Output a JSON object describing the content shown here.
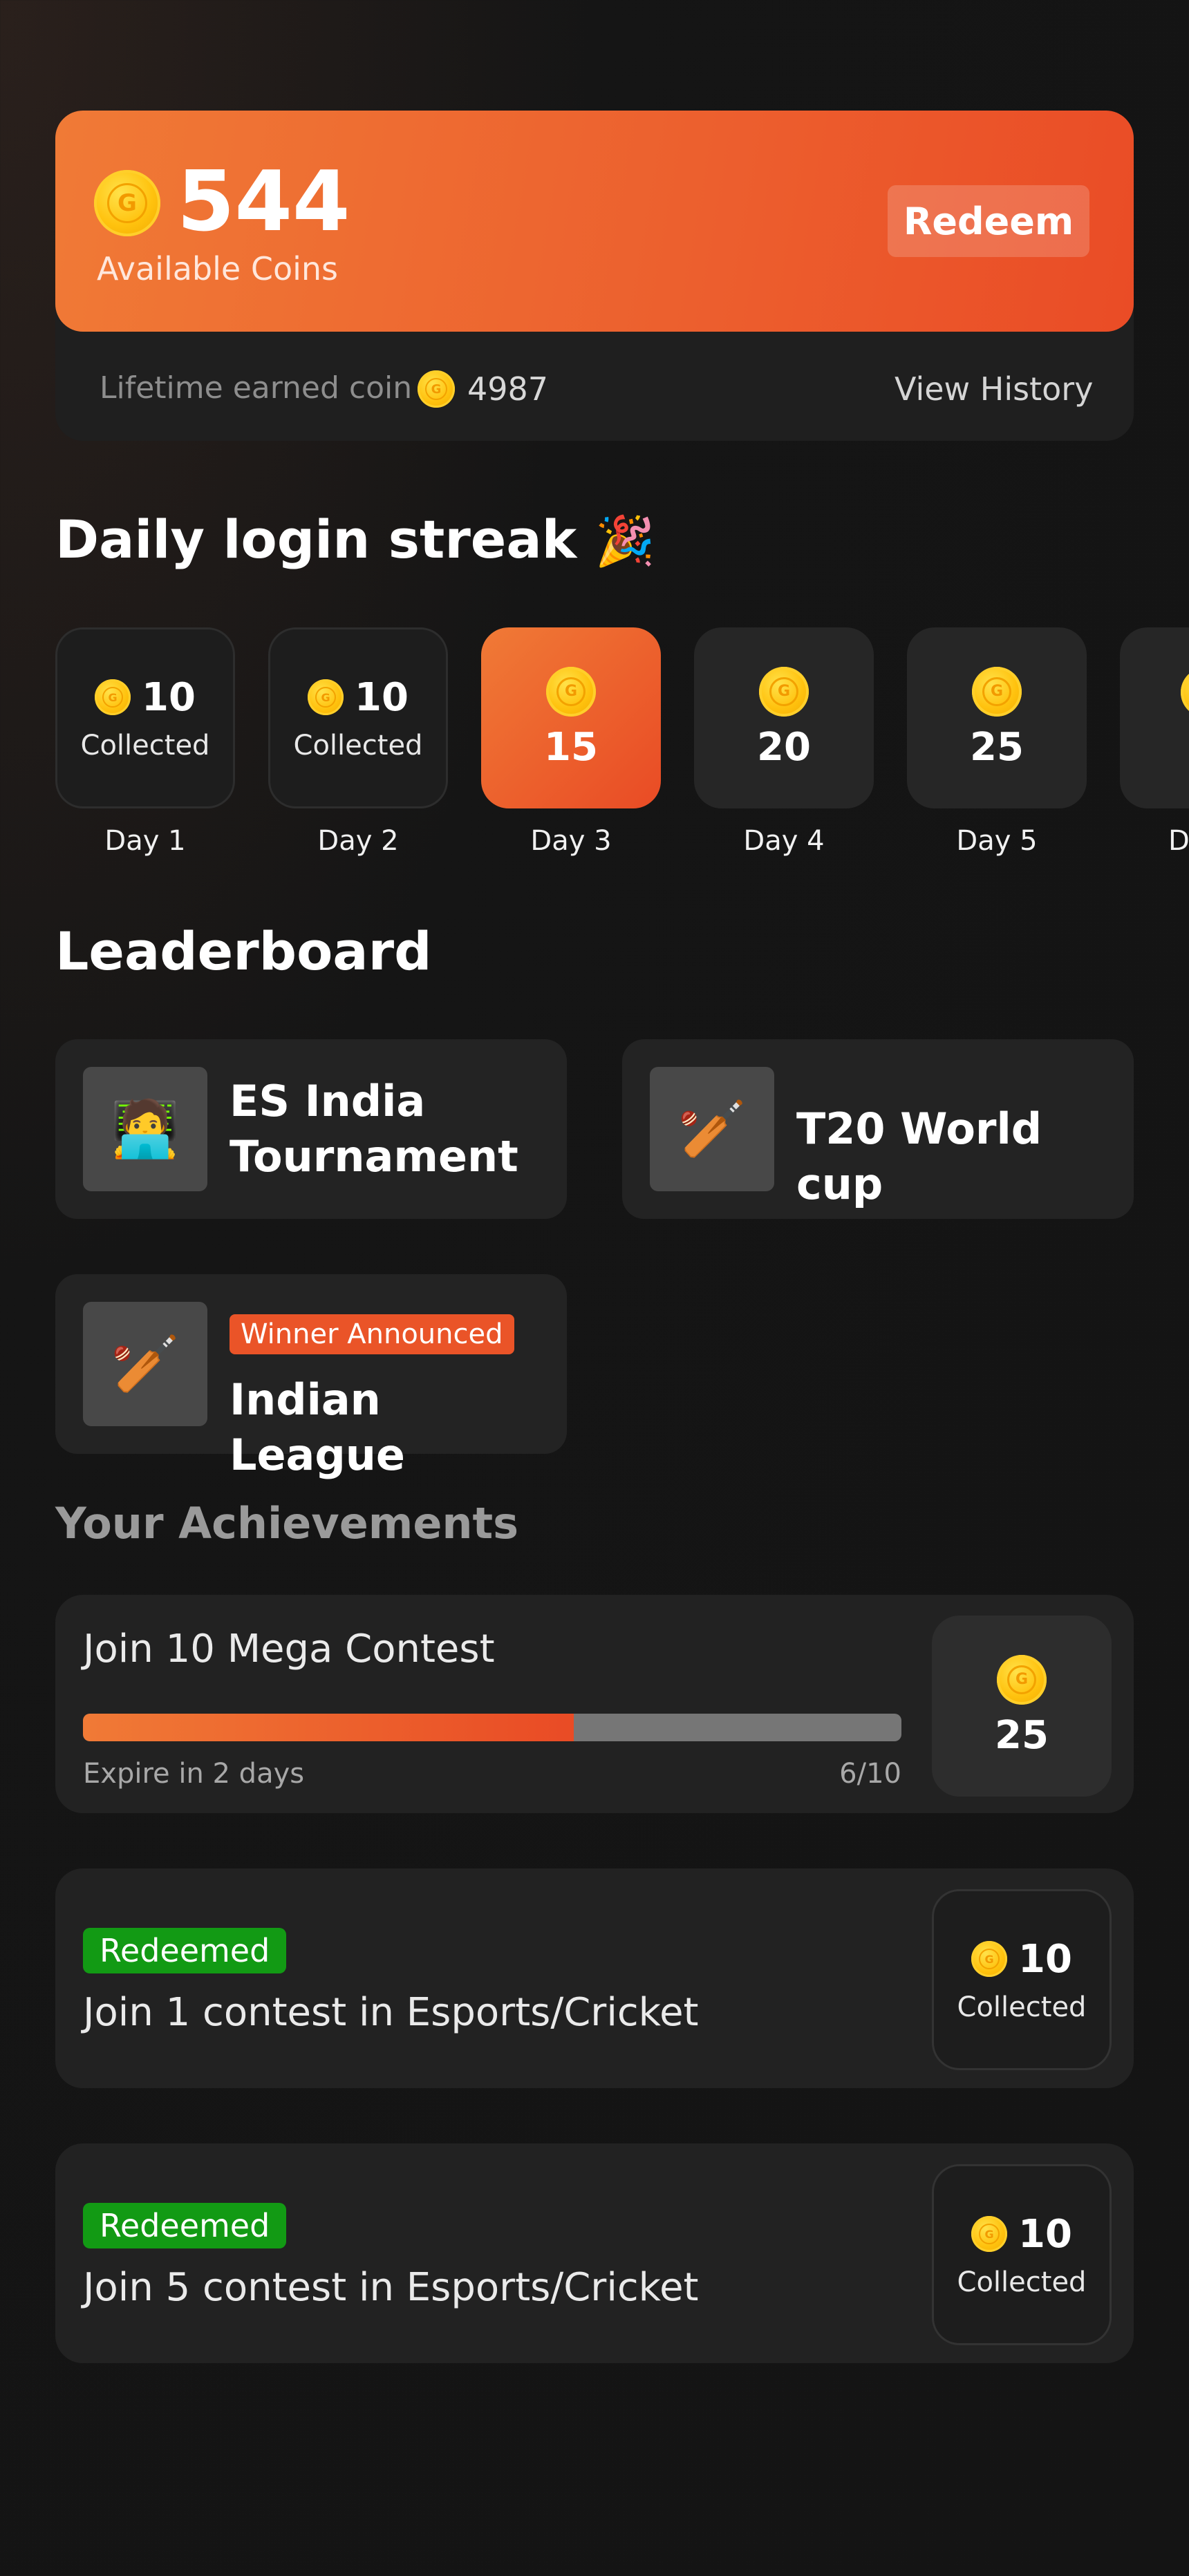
{
  "coins": {
    "available": "544",
    "available_label": "Available Coins",
    "redeem_label": "Redeem",
    "lifetime_label": "Lifetime earned coin",
    "lifetime_value": "4987",
    "history_label": "View History"
  },
  "streak": {
    "title": "Daily login streak",
    "emoji": "🎉",
    "days": [
      {
        "label": "Day 1",
        "amount": "10",
        "status": "Collected"
      },
      {
        "label": "Day 2",
        "amount": "10",
        "status": "Collected"
      },
      {
        "label": "Day 3",
        "amount": "15",
        "status": ""
      },
      {
        "label": "Day 4",
        "amount": "20",
        "status": ""
      },
      {
        "label": "Day 5",
        "amount": "25",
        "status": ""
      },
      {
        "label": "D",
        "amount": "",
        "status": ""
      }
    ]
  },
  "leaderboard": {
    "title": "Leaderboard",
    "items": [
      {
        "title_line1": "ES India",
        "title_line2": "Tournament",
        "icon": "esports-player-icon",
        "emoji": "🧑‍💻"
      },
      {
        "title": "T20 World cup",
        "icon": "cricket-icon",
        "emoji": "🏏"
      },
      {
        "title": "Indian League",
        "badge": "Winner Announced",
        "icon": "cricket-icon",
        "emoji": "🏏"
      }
    ]
  },
  "achievements": {
    "title": "Your Achievements",
    "items": [
      {
        "name": "Join 10 Mega Contest",
        "expire": "Expire in 2 days",
        "count": "6/10",
        "progress": 0.6,
        "reward": "25"
      },
      {
        "name": "Join 1 contest in Esports/Cricket",
        "status": "Redeemed",
        "reward": "10",
        "reward_status": "Collected"
      },
      {
        "name": "Join 5 contest in Esports/Cricket",
        "status": "Redeemed",
        "reward": "10",
        "reward_status": "Collected"
      }
    ]
  },
  "colors": {
    "accent": "#ec5f2e",
    "coin": "#ffc20e",
    "redeemed": "#129a14",
    "background": "#141414"
  }
}
